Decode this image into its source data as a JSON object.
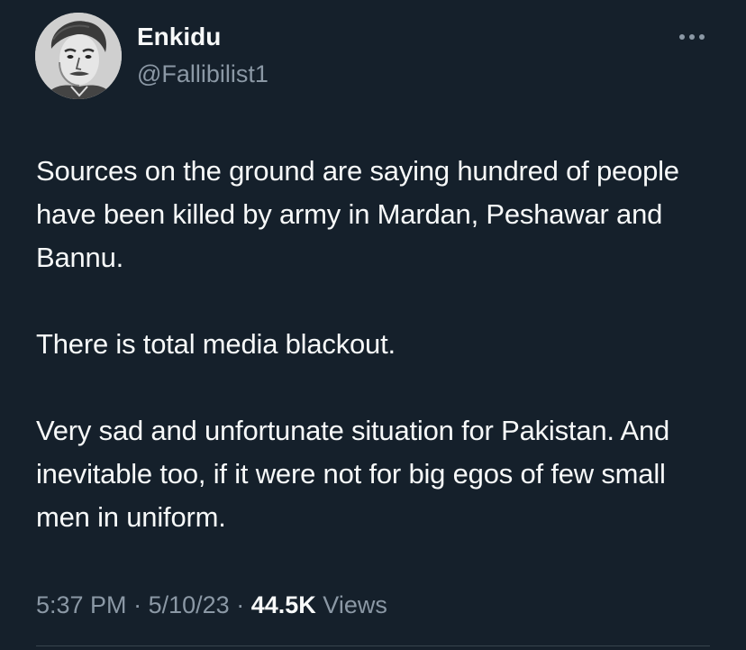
{
  "author": {
    "display_name": "Enkidu",
    "handle": "@Fallibilist1"
  },
  "tweet": {
    "paragraphs": [
      "Sources on the ground are saying hundred of people have been killed by army in Mardan, Peshawar and Bannu.",
      "There is total media blackout.",
      "Very sad and unfortunate situation for Pakistan. And inevitable too, if it were not for big egos of few small men in uniform."
    ],
    "time": "5:37 PM",
    "separator": "·",
    "date": "5/10/23",
    "views_count": "44.5K",
    "views_label": "Views"
  },
  "icons": {
    "more": "more-horizontal-icon"
  },
  "colors": {
    "background": "#15202b",
    "primary_text": "#f7f9f9",
    "secondary_text": "#8b98a5"
  }
}
